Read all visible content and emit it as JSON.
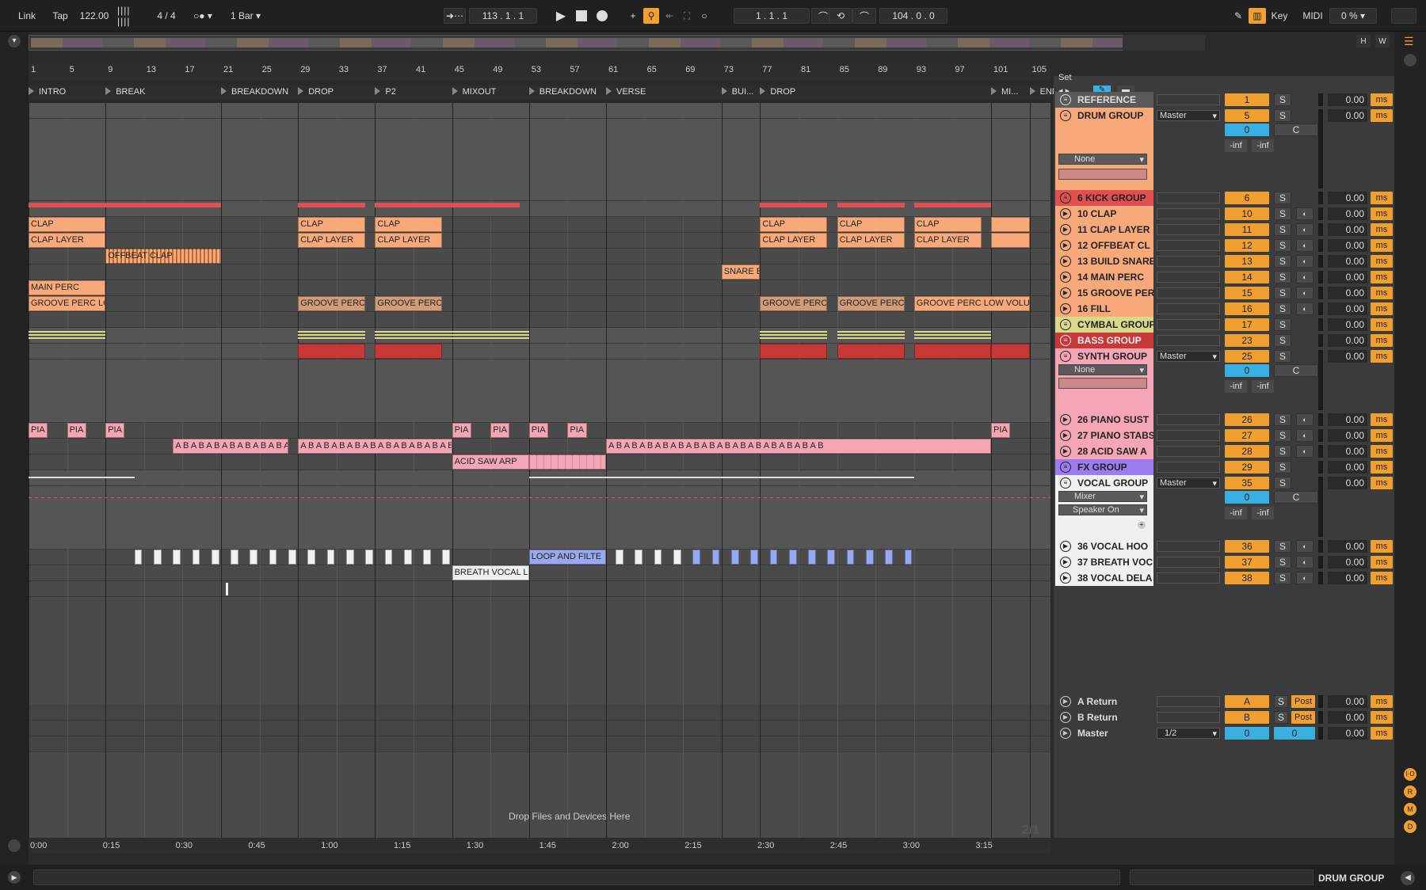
{
  "transport": {
    "link": "Link",
    "tap": "Tap",
    "tempo": "122.00",
    "signature": "4 / 4",
    "quantize": "1 Bar",
    "position": "113 .  1 .  1",
    "loop_start": "1 .  1 .  1",
    "loop_length": "104 .  0 .  0",
    "key_label": "Key",
    "midi_label": "MIDI",
    "cpu": "0 %"
  },
  "overview": {
    "h_label": "H",
    "w_label": "W"
  },
  "ruler": [
    "1",
    "5",
    "9",
    "13",
    "17",
    "21",
    "25",
    "29",
    "33",
    "37",
    "41",
    "45",
    "49",
    "53",
    "57",
    "61",
    "65",
    "69",
    "73",
    "77",
    "81",
    "85",
    "89",
    "93",
    "97",
    "101",
    "105"
  ],
  "locators": [
    {
      "label": "INTRO",
      "bar": 1
    },
    {
      "label": "BREAK",
      "bar": 9
    },
    {
      "label": "BREAKDOWN",
      "bar": 21
    },
    {
      "label": "DROP",
      "bar": 29
    },
    {
      "label": "P2",
      "bar": 37
    },
    {
      "label": "MIXOUT",
      "bar": 45
    },
    {
      "label": "BREAKDOWN",
      "bar": 53
    },
    {
      "label": "VERSE",
      "bar": 61
    },
    {
      "label": "BUI...",
      "bar": 73
    },
    {
      "label": "DROP",
      "bar": 77
    },
    {
      "label": "MI...",
      "bar": 101
    },
    {
      "label": "END",
      "bar": 105
    }
  ],
  "set_label": "Set",
  "drop_message": "Drop Files and Devices Here",
  "time_ruler": [
    "0:00",
    "0:15",
    "0:30",
    "0:45",
    "1:00",
    "1:15",
    "1:30",
    "1:45",
    "2:00",
    "2:15",
    "2:30",
    "2:45",
    "3:00",
    "3:15"
  ],
  "overview_page": "2/1",
  "status_track": "DRUM GROUP",
  "tracks": [
    {
      "name": "REFERENCE",
      "num": "1",
      "color": "#5a5a5a",
      "text": "#ddd",
      "icon": "group",
      "vol": "0.00",
      "h": 20
    },
    {
      "name": "DRUM GROUP",
      "num": "5",
      "color": "#f7a97a",
      "text": "#222",
      "icon": "group",
      "vol": "0.00",
      "h": 104,
      "route": "Master",
      "device": "None",
      "pan": "0",
      "pan2": "C",
      "inf1": "-inf",
      "inf2": "-inf"
    },
    {
      "name": "6 KICK GROUP",
      "num": "6",
      "color": "#e05050",
      "text": "#222",
      "icon": "group",
      "vol": "0.00",
      "h": 20
    },
    {
      "name": "10 CLAP",
      "num": "10",
      "color": "#f7a97a",
      "text": "#222",
      "icon": "play",
      "vol": "0.00",
      "h": 20
    },
    {
      "name": "11 CLAP LAYER",
      "num": "11",
      "color": "#f7a97a",
      "text": "#222",
      "icon": "play",
      "vol": "0.00",
      "h": 20
    },
    {
      "name": "12 OFFBEAT CL",
      "num": "12",
      "color": "#f7a97a",
      "text": "#222",
      "icon": "play",
      "vol": "0.00",
      "h": 20
    },
    {
      "name": "13 BUILD SNARE",
      "num": "13",
      "color": "#f7a97a",
      "text": "#222",
      "icon": "play",
      "vol": "0.00",
      "h": 20
    },
    {
      "name": "14 MAIN PERC",
      "num": "14",
      "color": "#f7a97a",
      "text": "#222",
      "icon": "play",
      "vol": "0.00",
      "h": 20
    },
    {
      "name": "15 GROOVE PER",
      "num": "15",
      "color": "#f7a97a",
      "text": "#222",
      "icon": "play",
      "vol": "0.00",
      "h": 20
    },
    {
      "name": "16 FILL",
      "num": "16",
      "color": "#f7a97a",
      "text": "#222",
      "icon": "play",
      "vol": "0.00",
      "h": 20
    },
    {
      "name": "CYMBAL GROUP",
      "num": "17",
      "color": "#d9d98a",
      "text": "#222",
      "icon": "group",
      "vol": "0.00",
      "h": 20
    },
    {
      "name": "BASS GROUP",
      "num": "23",
      "color": "#c83838",
      "text": "#eee",
      "icon": "group",
      "vol": "0.00",
      "h": 20
    },
    {
      "name": "SYNTH GROUP",
      "num": "25",
      "color": "#f4a6b6",
      "text": "#222",
      "icon": "group",
      "vol": "0.00",
      "h": 80,
      "route": "Master",
      "device": "None",
      "pan": "0",
      "pan2": "C",
      "inf1": "-inf",
      "inf2": "-inf"
    },
    {
      "name": "26 PIANO SUST",
      "num": "26",
      "color": "#f4a6b6",
      "text": "#222",
      "icon": "play",
      "vol": "0.00",
      "h": 20
    },
    {
      "name": "27 PIANO STABS",
      "num": "27",
      "color": "#f4a6b6",
      "text": "#222",
      "icon": "play",
      "vol": "0.00",
      "h": 20
    },
    {
      "name": "28 ACID SAW A",
      "num": "28",
      "color": "#f4a6b6",
      "text": "#222",
      "icon": "play",
      "vol": "0.00",
      "h": 20
    },
    {
      "name": "FX GROUP",
      "num": "29",
      "color": "#9d7cf0",
      "text": "#222",
      "icon": "group",
      "vol": "0.00",
      "h": 20
    },
    {
      "name": "VOCAL GROUP",
      "num": "35",
      "color": "#f0f0f0",
      "text": "#222",
      "icon": "group",
      "vol": "0.00",
      "h": 80,
      "route": "Master",
      "device": "Mixer",
      "device2": "Speaker On",
      "pan": "0",
      "pan2": "C",
      "inf1": "-inf",
      "inf2": "-inf"
    },
    {
      "name": "36 VOCAL HOO",
      "num": "36",
      "color": "#f0f0f0",
      "text": "#222",
      "icon": "play",
      "vol": "0.00",
      "h": 20
    },
    {
      "name": "37 BREATH VOC",
      "num": "37",
      "color": "#f0f0f0",
      "text": "#222",
      "icon": "play",
      "vol": "0.00",
      "h": 20
    },
    {
      "name": "38 VOCAL DELA",
      "num": "38",
      "color": "#f0f0f0",
      "text": "#222",
      "icon": "play",
      "vol": "0.00",
      "h": 20
    }
  ],
  "returns": [
    {
      "name": "A Return",
      "num": "A",
      "vol": "0.00",
      "post": "Post"
    },
    {
      "name": "B Return",
      "num": "B",
      "vol": "0.00",
      "post": "Post"
    }
  ],
  "master": {
    "name": "Master",
    "route": "1/2",
    "num": "0",
    "num2": "0",
    "vol": "0.00"
  },
  "ms_label": "ms",
  "s_label": "S",
  "clips": {
    "clap": "CLAP",
    "clap_layer": "CLAP LAYER",
    "offbeat": "OFFBEAT CLAP",
    "snare": "SNARE B",
    "main_perc": "MAIN PERC",
    "groove1": "GROOVE PERC LO",
    "groove": "GROOVE PERC",
    "groove_last": "GROOVE PERC LOW VOLU",
    "pia": "PIA",
    "ab": "A B A B A B A B A B A B A B A B A B A B A B A B A B A B",
    "acid": "ACID SAW ARP",
    "loop": "LOOP AND FILTE",
    "breath": "BREATH VOCAL L"
  }
}
